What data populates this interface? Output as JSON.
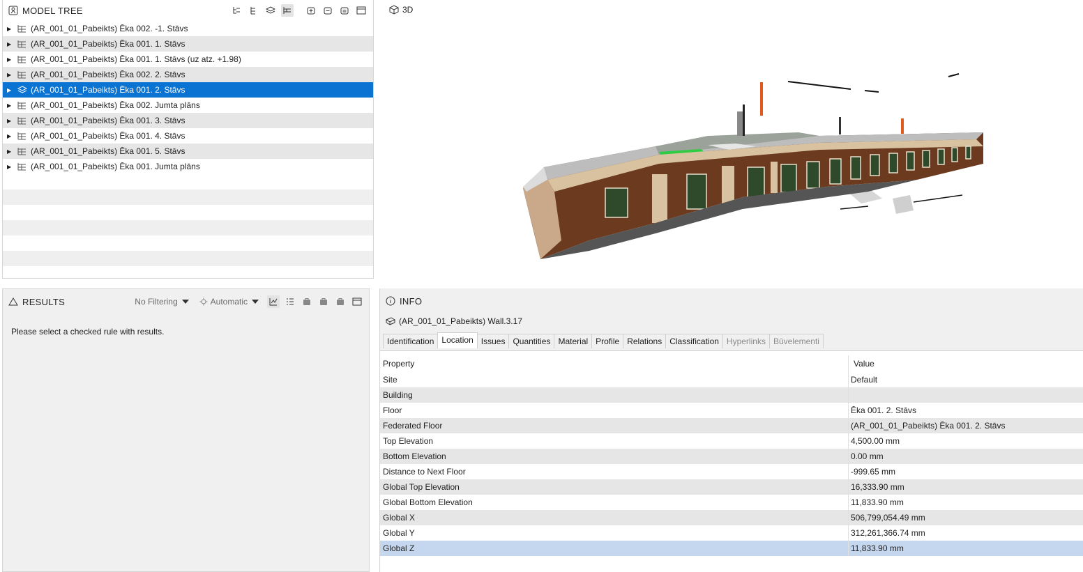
{
  "model_tree": {
    "title": "MODEL TREE",
    "items": [
      {
        "label": "(AR_001_01_Pabeikts) Ēka 002.  -1. Stāvs"
      },
      {
        "label": "(AR_001_01_Pabeikts) Ēka 001. 1. Stāvs"
      },
      {
        "label": "(AR_001_01_Pabeikts) Ēka 001. 1. Stāvs (uz atz. +1.98)"
      },
      {
        "label": "(AR_001_01_Pabeikts) Ēka 002. 2. Stāvs"
      },
      {
        "label": "(AR_001_01_Pabeikts) Ēka 001. 2. Stāvs"
      },
      {
        "label": "(AR_001_01_Pabeikts) Ēka 002. Jumta plāns"
      },
      {
        "label": "(AR_001_01_Pabeikts) Ēka 001. 3. Stāvs"
      },
      {
        "label": "(AR_001_01_Pabeikts) Ēka 001. 4. Stāvs"
      },
      {
        "label": "(AR_001_01_Pabeikts) Ēka 001. 5. Stāvs"
      },
      {
        "label": "(AR_001_01_Pabeikts) Ēka 001. Jumta plāns"
      }
    ],
    "selected_index": 4
  },
  "view3d": {
    "title": "3D"
  },
  "results": {
    "title": "RESULTS",
    "filter_label": "No Filtering",
    "mode_label": "Automatic",
    "message": "Please select a checked rule with results."
  },
  "info": {
    "title": "INFO",
    "element": "(AR_001_01_Pabeikts) Wall.3.17",
    "tabs": [
      {
        "label": "Identification"
      },
      {
        "label": "Location"
      },
      {
        "label": "Issues"
      },
      {
        "label": "Quantities"
      },
      {
        "label": "Material"
      },
      {
        "label": "Profile"
      },
      {
        "label": "Relations"
      },
      {
        "label": "Classification"
      },
      {
        "label": "Hyperlinks"
      },
      {
        "label": "Būvelementi"
      }
    ],
    "active_tab": "Location",
    "columns": {
      "property": "Property",
      "value": "Value"
    },
    "rows": [
      {
        "property": "Site",
        "value": "Default"
      },
      {
        "property": "Building",
        "value": ""
      },
      {
        "property": "Floor",
        "value": "Ēka 001. 2. Stāvs"
      },
      {
        "property": "Federated Floor",
        "value": "(AR_001_01_Pabeikts) Ēka 001. 2. Stāvs"
      },
      {
        "property": "Top Elevation",
        "value": "4,500.00 mm"
      },
      {
        "property": "Bottom Elevation",
        "value": "0.00 mm"
      },
      {
        "property": "Distance to Next Floor",
        "value": "-999.65 mm"
      },
      {
        "property": "Global Top Elevation",
        "value": "16,333.90 mm"
      },
      {
        "property": "Global Bottom Elevation",
        "value": "11,833.90 mm"
      },
      {
        "property": "Global X",
        "value": "506,799,054.49 mm"
      },
      {
        "property": "Global Y",
        "value": "312,261,366.74 mm"
      },
      {
        "property": "Global Z",
        "value": "11,833.90 mm"
      }
    ]
  },
  "colors": {
    "selection": "#0b73d1",
    "row_selected": "#c5d7ee",
    "alt_row": "#e6e6e6"
  }
}
